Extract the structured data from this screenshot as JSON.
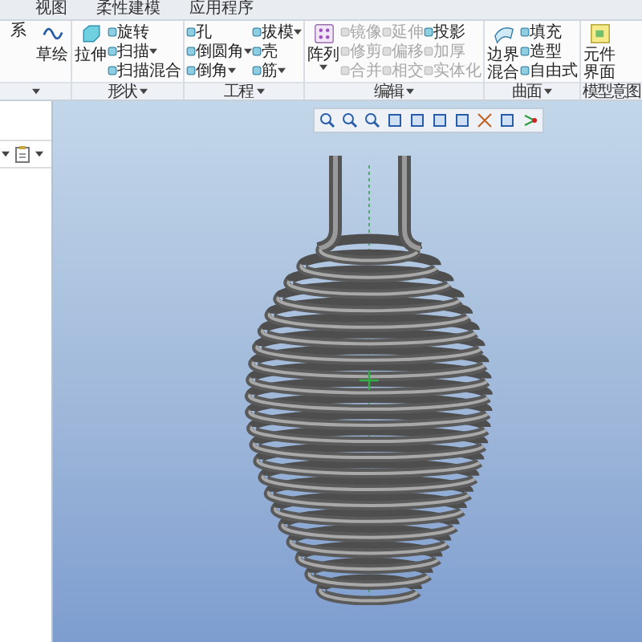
{
  "tabs": [
    {
      "label": "视图",
      "selected": false
    },
    {
      "label": "柔性建模",
      "selected": false
    },
    {
      "label": "应用程序",
      "selected": false
    }
  ],
  "ribbon": {
    "groups": [
      {
        "columns": [
          {
            "kind": "large",
            "items": [
              {
                "label": "系",
                "dropdown": false,
                "disabled": false
              }
            ]
          },
          {
            "kind": "large",
            "items": [
              {
                "label": "草绘",
                "dropdown": false,
                "disabled": false
              }
            ]
          }
        ]
      },
      {
        "label": "形状",
        "columns": [
          {
            "kind": "large",
            "items": [
              {
                "label": "拉伸",
                "dropdown": false,
                "disabled": false
              }
            ]
          },
          {
            "kind": "stack",
            "items": [
              {
                "label": "旋转",
                "dropdown": false,
                "disabled": false
              },
              {
                "label": "扫描",
                "dropdown": true,
                "disabled": false
              },
              {
                "label": "扫描混合",
                "dropdown": false,
                "disabled": false
              }
            ]
          }
        ]
      },
      {
        "label": "工程",
        "columns": [
          {
            "kind": "stack",
            "items": [
              {
                "label": "孔",
                "dropdown": false,
                "disabled": false
              },
              {
                "label": "倒圆角",
                "dropdown": true,
                "disabled": false
              },
              {
                "label": "倒角",
                "dropdown": true,
                "disabled": false
              }
            ]
          },
          {
            "kind": "stack",
            "items": [
              {
                "label": "拔模",
                "dropdown": true,
                "disabled": false
              },
              {
                "label": "壳",
                "dropdown": false,
                "disabled": false
              },
              {
                "label": "筋",
                "dropdown": true,
                "disabled": false
              }
            ]
          }
        ]
      },
      {
        "label": "编辑",
        "columns": [
          {
            "kind": "large",
            "items": [
              {
                "label": "阵列",
                "dropdown": true,
                "disabled": false
              }
            ]
          },
          {
            "kind": "stack",
            "items": [
              {
                "label": "镜像",
                "dropdown": false,
                "disabled": true
              },
              {
                "label": "修剪",
                "dropdown": false,
                "disabled": true
              },
              {
                "label": "合并",
                "dropdown": false,
                "disabled": true
              }
            ]
          },
          {
            "kind": "stack",
            "items": [
              {
                "label": "延伸",
                "dropdown": false,
                "disabled": true
              },
              {
                "label": "偏移",
                "dropdown": false,
                "disabled": true
              },
              {
                "label": "相交",
                "dropdown": false,
                "disabled": true
              }
            ]
          },
          {
            "kind": "stack",
            "items": [
              {
                "label": "投影",
                "dropdown": false,
                "disabled": false
              },
              {
                "label": "加厚",
                "dropdown": false,
                "disabled": true
              },
              {
                "label": "实体化",
                "dropdown": false,
                "disabled": true
              }
            ]
          }
        ]
      },
      {
        "label": "曲面",
        "columns": [
          {
            "kind": "large",
            "items": [
              {
                "label": "边界混合",
                "dropdown": false,
                "disabled": false
              }
            ]
          },
          {
            "kind": "stack",
            "items": [
              {
                "label": "填充",
                "dropdown": false,
                "disabled": false
              },
              {
                "label": "造型",
                "dropdown": false,
                "disabled": false
              },
              {
                "label": "自由式",
                "dropdown": false,
                "disabled": false
              }
            ]
          }
        ]
      },
      {
        "label": "模型意图",
        "columns": [
          {
            "kind": "large",
            "items": [
              {
                "label": "元件界面",
                "dropdown": false,
                "disabled": false
              }
            ]
          }
        ]
      }
    ]
  }
}
